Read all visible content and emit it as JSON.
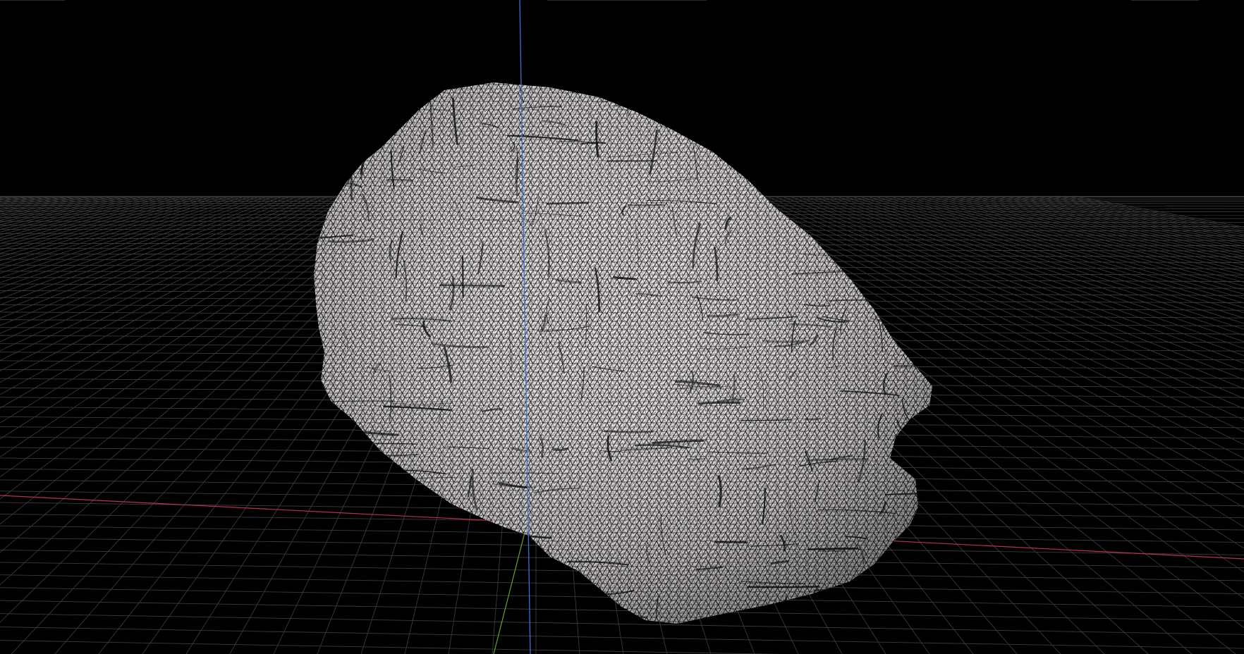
{
  "viewport": {
    "mode": "3d-perspective",
    "background_color": "#000000",
    "grid_color": "#3a3a3a",
    "shading": "wireframe-on-shaded",
    "mesh_fill_color": "#e4dfe3",
    "mesh_wire_color": "#0c0c0c",
    "mesh_object": "rock-scan-mesh"
  },
  "axes": {
    "x_axis_color": "#c0304a",
    "y_axis_color": "#3f6fd6",
    "z_axis_color": "#6aa02c"
  }
}
